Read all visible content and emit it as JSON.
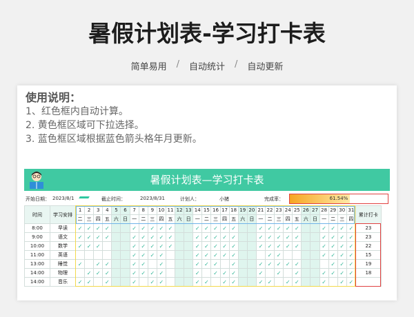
{
  "page": {
    "title": "暑假计划表-学习打卡表",
    "tags": [
      "简单易用",
      "自动统计",
      "自动更新"
    ],
    "tag_separator": "/"
  },
  "instructions": {
    "heading": "使用说明：",
    "lines": [
      "1、红色框内自动计算。",
      "2. 黄色框区域可下拉选择。",
      "3. 蓝色框区域根据蓝色箭头格年月更新。"
    ]
  },
  "sheet": {
    "banner_title": "暑假计划表—学习打卡表",
    "start_label": "开始日期：",
    "start_value": "2023/8/1",
    "end_label": "截止时间：",
    "end_value": "2023/8/31",
    "planner_label": "计划人：",
    "planner_value": "小猪",
    "rate_label": "完成率：",
    "rate_value": "61.54%",
    "rate_fraction": 0.6154,
    "col_time": "时间",
    "col_plan": "学习安排",
    "col_total": "累计打卡",
    "check_mark": "✓",
    "days": [
      "1",
      "2",
      "3",
      "4",
      "5",
      "6",
      "7",
      "8",
      "9",
      "10",
      "11",
      "12",
      "13",
      "14",
      "15",
      "16",
      "17",
      "18",
      "19",
      "20",
      "21",
      "22",
      "23",
      "24",
      "25",
      "26",
      "27",
      "28",
      "29",
      "30",
      "31"
    ],
    "weekdays": [
      "二",
      "三",
      "四",
      "五",
      "六",
      "日",
      "一",
      "二",
      "三",
      "四",
      "五",
      "六",
      "日",
      "一",
      "二",
      "三",
      "四",
      "五",
      "六",
      "日",
      "一",
      "二",
      "三",
      "四",
      "五",
      "六",
      "日",
      "一",
      "二",
      "三",
      "四"
    ],
    "rows": [
      {
        "time": "8:00",
        "task": "早读",
        "total": "23",
        "checks": [
          1,
          1,
          1,
          1,
          0,
          0,
          1,
          1,
          1,
          1,
          1,
          0,
          0,
          1,
          1,
          1,
          1,
          1,
          0,
          0,
          1,
          1,
          1,
          1,
          1,
          0,
          0,
          1,
          1,
          1,
          1
        ]
      },
      {
        "time": "9:00",
        "task": "语文",
        "total": "23",
        "checks": [
          1,
          1,
          1,
          1,
          0,
          0,
          1,
          1,
          1,
          1,
          1,
          0,
          0,
          1,
          1,
          1,
          1,
          1,
          0,
          0,
          1,
          1,
          1,
          1,
          1,
          0,
          0,
          1,
          1,
          1,
          1
        ]
      },
      {
        "time": "10:00",
        "task": "数学",
        "total": "22",
        "checks": [
          1,
          1,
          1,
          0,
          0,
          0,
          1,
          1,
          1,
          1,
          1,
          0,
          0,
          1,
          1,
          1,
          1,
          1,
          0,
          0,
          1,
          1,
          1,
          1,
          1,
          0,
          0,
          1,
          1,
          1,
          1
        ]
      },
      {
        "time": "11:00",
        "task": "英语",
        "total": "15",
        "checks": [
          0,
          0,
          0,
          0,
          0,
          0,
          1,
          1,
          1,
          1,
          0,
          0,
          0,
          1,
          1,
          1,
          1,
          1,
          0,
          0,
          0,
          1,
          1,
          0,
          0,
          0,
          0,
          1,
          1,
          1,
          1
        ]
      },
      {
        "time": "13:00",
        "task": "睡觉",
        "total": "19",
        "checks": [
          1,
          0,
          1,
          1,
          0,
          0,
          1,
          1,
          0,
          1,
          0,
          0,
          0,
          1,
          1,
          1,
          0,
          1,
          0,
          0,
          1,
          1,
          1,
          1,
          1,
          0,
          0,
          0,
          1,
          1,
          1
        ]
      },
      {
        "time": "14:00",
        "task": "物理",
        "total": "18",
        "checks": [
          0,
          1,
          1,
          1,
          0,
          0,
          1,
          1,
          1,
          1,
          0,
          0,
          0,
          1,
          0,
          1,
          1,
          1,
          0,
          0,
          1,
          0,
          1,
          0,
          1,
          0,
          0,
          1,
          1,
          1,
          1
        ]
      },
      {
        "time": "14:00",
        "task": "音乐",
        "total": "",
        "checks": [
          1,
          1,
          0,
          1,
          0,
          0,
          1,
          0,
          1,
          1,
          0,
          0,
          0,
          1,
          1,
          0,
          1,
          1,
          0,
          0,
          1,
          1,
          0,
          1,
          1,
          0,
          0,
          1,
          0,
          1,
          1
        ]
      }
    ]
  },
  "colors": {
    "banner": "#40c9a2",
    "weekend_fill": "#dff5ee",
    "check": "#2bb394",
    "red_frame": "#e04040",
    "yellow_frame": "#f2d94a",
    "blue_frame": "#6fb3e8"
  },
  "icons": {
    "mascot": "student-reading-icon"
  }
}
